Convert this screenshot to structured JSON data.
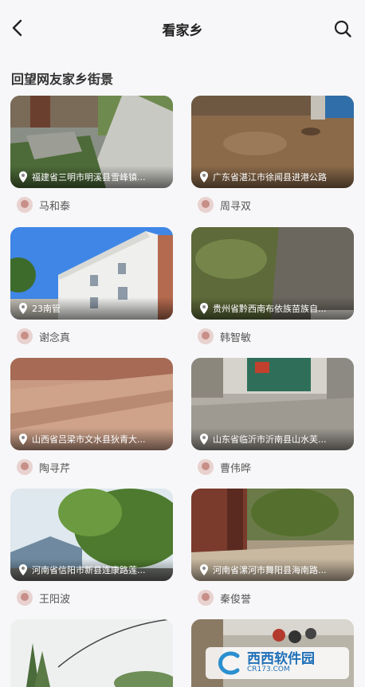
{
  "header": {
    "title": "看家乡"
  },
  "section": {
    "title": "回望网友家乡街景"
  },
  "cards": [
    {
      "location": "福建省三明市明溪县雪峰镇...",
      "user": "马和泰"
    },
    {
      "location": "广东省湛江市徐闻县进港公路",
      "user": "周寻双"
    },
    {
      "location": "23南管",
      "user": "谢念真"
    },
    {
      "location": "贵州省黔西南布依族苗族自...",
      "user": "韩智敏"
    },
    {
      "location": "山西省吕梁市文水县狄青大...",
      "user": "陶寻芹"
    },
    {
      "location": "山东省临沂市沂南县山水芙...",
      "user": "曹伟晔"
    },
    {
      "location": "河南省信阳市新县连康路莲...",
      "user": "王阳波"
    },
    {
      "location": "河南省漯河市舞阳县海南路...",
      "user": "秦俊誉"
    },
    {
      "location": "",
      "user": ""
    },
    {
      "location": "",
      "user": ""
    }
  ],
  "watermark": {
    "text": "西西软件园",
    "sub": "CR173.COM"
  }
}
